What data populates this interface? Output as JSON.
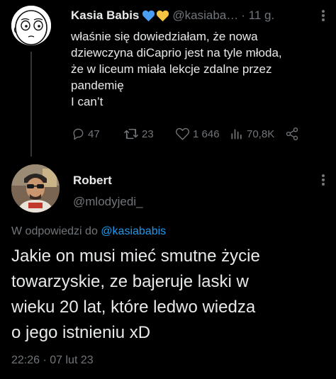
{
  "original_tweet": {
    "author_name": "Kasia Babis",
    "handle": "@kasiaba…",
    "time": "· 11 g.",
    "text_lines": [
      "właśnie się dowiedziałam, że nowa",
      "dziewczyna diCaprio jest na tyle młoda,",
      "że w liceum miała lekcje zdalne przez",
      "pandemię",
      "I can’t"
    ],
    "replies": "47",
    "retweets": "23",
    "likes": "1 646",
    "views": "70,8K",
    "heart_colors": [
      "#4a9df0",
      "#f5c542"
    ]
  },
  "reply_tweet": {
    "author_name": "Robert",
    "handle": "@mlodyjedi_",
    "replying_prefix": "W odpowiedzi do",
    "replying_to": "@kasiababis",
    "text_lines": [
      "Jakie on musi mieć smutne życie",
      "towarzyskie, ze bajeruje laski w",
      "wieku 20 lat, które ledwo wiedza",
      "o jego istnieniu xD"
    ],
    "timestamp": "22:26 · 07 lut 23"
  },
  "colors": {
    "background": "#000000",
    "text": "#e7e9ea",
    "muted": "#71767b",
    "link": "#1d9bf0"
  }
}
